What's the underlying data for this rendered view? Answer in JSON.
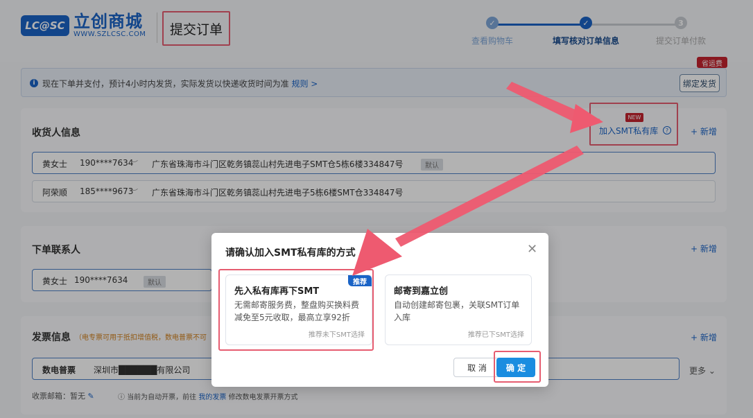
{
  "header": {
    "logo_mark": "LC@SC",
    "logo_cn": "立创商城",
    "logo_url": "WWW.SZLCSC.COM",
    "page_title": "提交订单",
    "steps": [
      {
        "label": "查看购物车",
        "state": "done"
      },
      {
        "label": "填写核对订单信息",
        "state": "active"
      },
      {
        "label": "提交订单付款",
        "state": "pending",
        "number": "3"
      }
    ]
  },
  "notice": {
    "text": "现在下单并支付，预计4小时内发货，实际发货以快递收货时间为准",
    "link": "规则 >",
    "bind_button": "绑定发货",
    "save_badge": "省运费"
  },
  "receiver": {
    "title": "收货人信息",
    "smt_link": "加入SMT私有库",
    "new_badge": "NEW",
    "add": "+ 新增",
    "rows": [
      {
        "name": "黄女士",
        "phone": "190****7634",
        "address": "广东省珠海市斗门区乾务镇蕊山村先进电子SMT仓5栋6楼334847号",
        "tag": "默认"
      },
      {
        "name": "阿荣顺",
        "phone": "185****9673",
        "address": "广东省珠海市斗门区乾务镇蕊山村先进电子5栋6楼SMT仓334847号",
        "tag": ""
      }
    ]
  },
  "contact": {
    "title": "下单联系人",
    "add": "+ 新增",
    "name": "黄女士",
    "phone": "190****7634",
    "tag": "默认"
  },
  "invoice": {
    "title": "发票信息",
    "note": "（电专票可用于抵扣增值税，数电普票不可",
    "add": "+ 新增",
    "type": "数电普票",
    "company": "深圳市██████有限公司",
    "more": "更多",
    "email_label": "收票邮箱：暂无",
    "hint": "当前为自动开票，前往",
    "hint_link": "我的发票",
    "hint_tail": "修改数电发票开票方式"
  },
  "modal": {
    "title": "请确认加入SMT私有库的方式",
    "options": [
      {
        "title": "先入私有库再下SMT",
        "desc": "无需邮寄服务费，整盘购买换料费减免至5元收取，最高立享92折",
        "note": "推荐未下SMT选择",
        "badge": "推荐"
      },
      {
        "title": "邮寄到嘉立创",
        "desc": "自动创建邮寄包裹，关联SMT订单入库",
        "note": "推荐已下SMT选择",
        "badge": ""
      }
    ],
    "cancel": "取 消",
    "confirm": "确 定"
  },
  "colors": {
    "brand": "#1a63c6",
    "highlight": "#e65c70",
    "confirm": "#1a8de0"
  }
}
